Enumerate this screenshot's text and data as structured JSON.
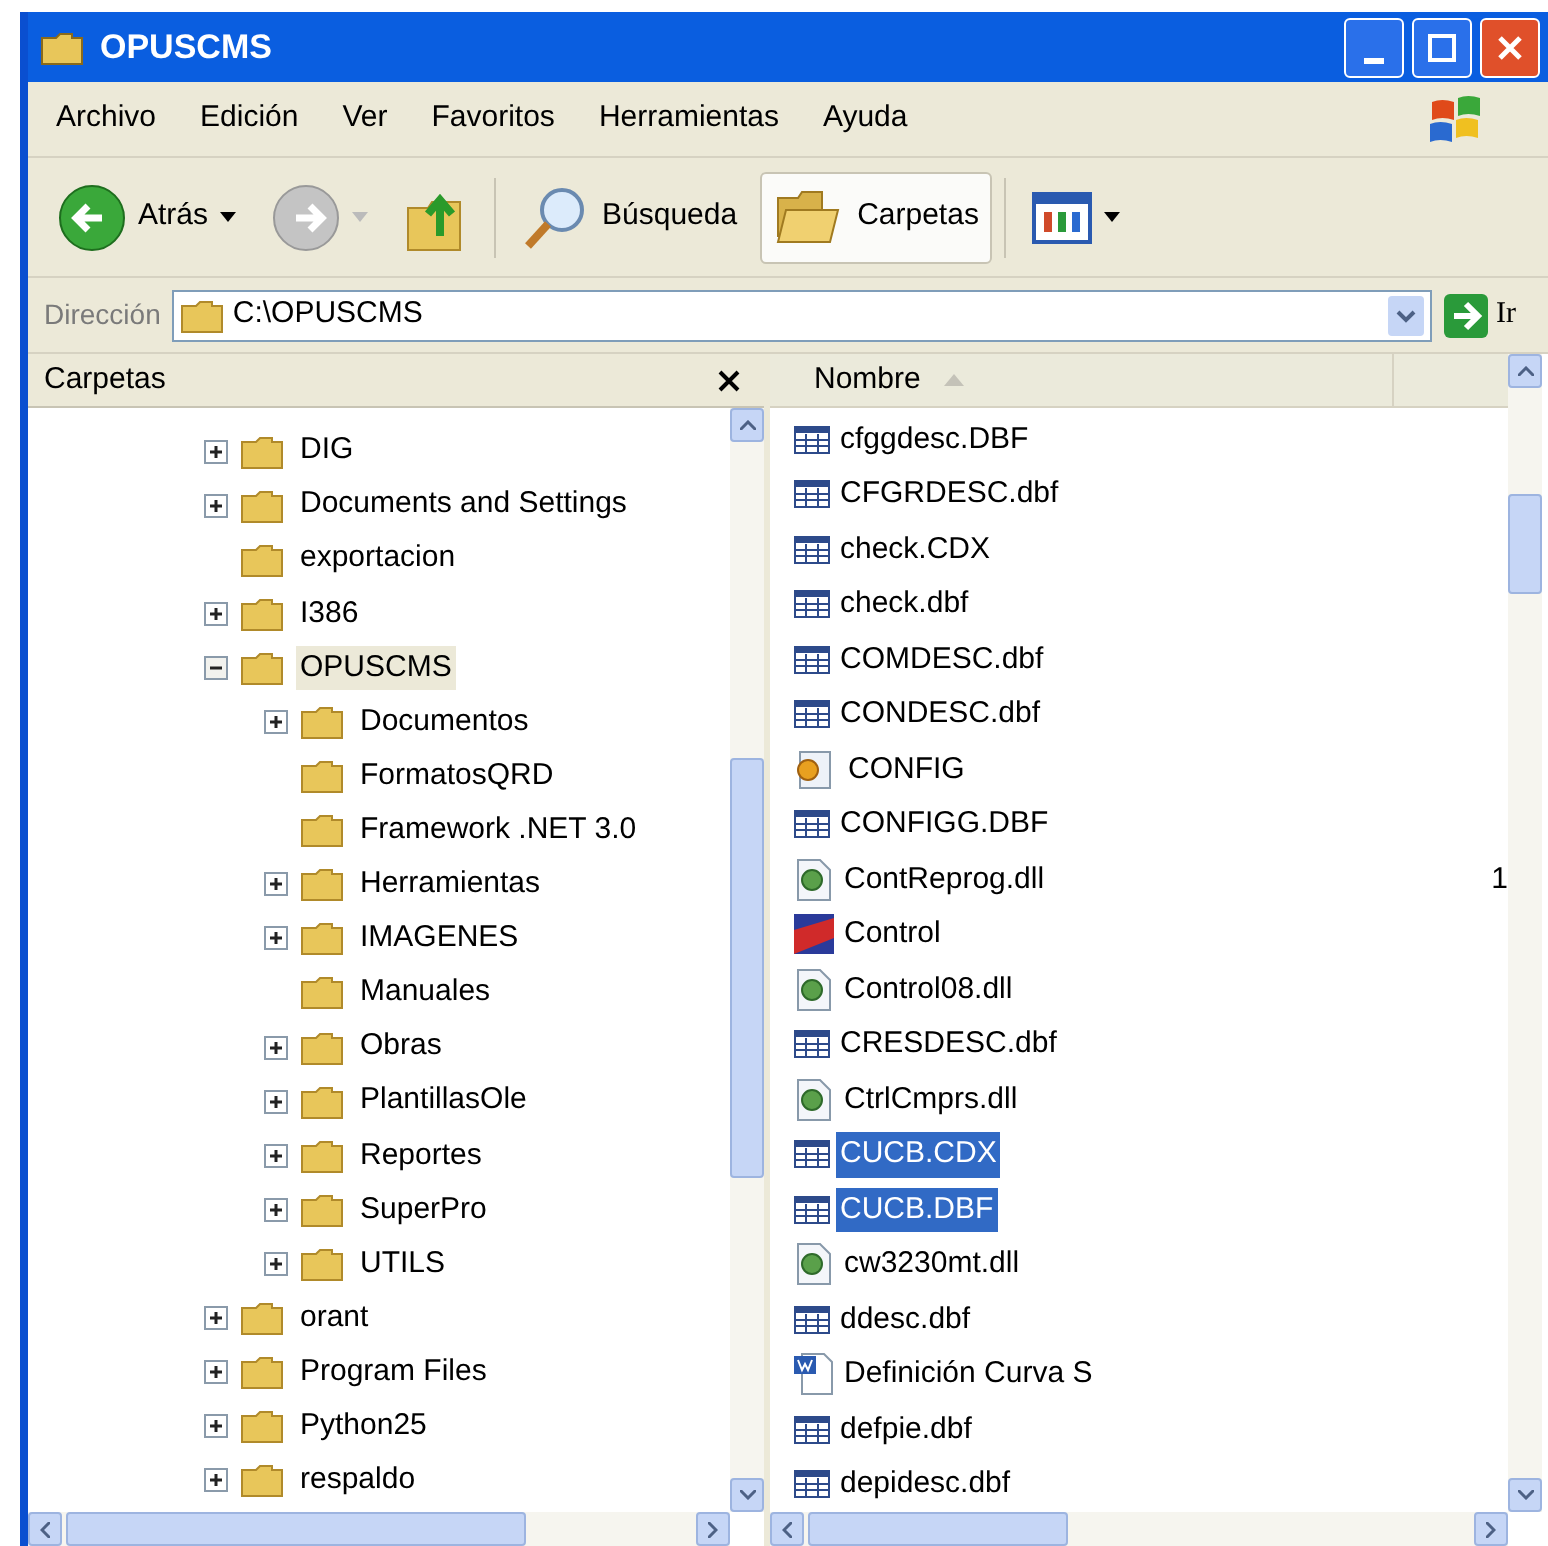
{
  "window": {
    "title": "OPUSCMS"
  },
  "menu": [
    "Archivo",
    "Edición",
    "Ver",
    "Favoritos",
    "Herramientas",
    "Ayuda"
  ],
  "toolbar": [
    {
      "kind": "back",
      "label": "Atrás",
      "disabled": false
    },
    {
      "kind": "forward",
      "disabled": true
    },
    {
      "kind": "up",
      "disabled": false
    },
    {
      "kind": "search",
      "label": "Búsqueda",
      "selected": false
    },
    {
      "kind": "folders",
      "label": "Carpetas",
      "selected": true
    },
    {
      "kind": "views"
    }
  ],
  "address": {
    "label": "Dirección",
    "value": "C:\\OPUSCMS",
    "go": "Ir"
  },
  "folders_pane": {
    "title": "Carpetas",
    "items": [
      {
        "name": "DIG",
        "has_children": true,
        "expanded": false,
        "selected": false
      },
      {
        "name": "Documents and Settings",
        "has_children": true,
        "expanded": false,
        "selected": false
      },
      {
        "name": "exportacion",
        "has_children": false,
        "selected": false
      },
      {
        "name": "I386",
        "has_children": true,
        "expanded": false,
        "selected": false
      },
      {
        "name": "OPUSCMS",
        "has_children": true,
        "expanded": true,
        "selected": true,
        "children": [
          {
            "name": "Documentos",
            "has_children": true,
            "expanded": false,
            "selected": false
          },
          {
            "name": "FormatosQRD",
            "has_children": false,
            "selected": false
          },
          {
            "name": "Framework .NET 3.0",
            "has_children": false,
            "selected": false
          },
          {
            "name": "Herramientas",
            "has_children": true,
            "expanded": false,
            "selected": false
          },
          {
            "name": "IMAGENES",
            "has_children": true,
            "expanded": false,
            "selected": false
          },
          {
            "name": "Manuales",
            "has_children": false,
            "selected": false
          },
          {
            "name": "Obras",
            "has_children": true,
            "expanded": false,
            "selected": false
          },
          {
            "name": "PlantillasOle",
            "has_children": true,
            "expanded": false,
            "selected": false
          },
          {
            "name": "Reportes",
            "has_children": true,
            "expanded": false,
            "selected": false
          },
          {
            "name": "SuperPro",
            "has_children": true,
            "expanded": false,
            "selected": false
          },
          {
            "name": "UTILS",
            "has_children": true,
            "expanded": false,
            "selected": false
          }
        ]
      },
      {
        "name": "orant",
        "has_children": true,
        "expanded": false,
        "selected": false
      },
      {
        "name": "Program Files",
        "has_children": true,
        "expanded": false,
        "selected": false
      },
      {
        "name": "Python25",
        "has_children": true,
        "expanded": false,
        "selected": false
      },
      {
        "name": "respaldo",
        "has_children": true,
        "expanded": false,
        "selected": false
      }
    ]
  },
  "file_list": {
    "columns": [
      "Nombre"
    ],
    "rows": [
      {
        "name": "cfggdesc.DBF",
        "kind": "table",
        "selected": false
      },
      {
        "name": "CFGRDESC.dbf",
        "kind": "table",
        "selected": false
      },
      {
        "name": "check.CDX",
        "kind": "table",
        "selected": false
      },
      {
        "name": "check.dbf",
        "kind": "table",
        "selected": false
      },
      {
        "name": "COMDESC.dbf",
        "kind": "table",
        "selected": false
      },
      {
        "name": "CONDESC.dbf",
        "kind": "table",
        "selected": false
      },
      {
        "name": "CONFIG",
        "kind": "config",
        "selected": false
      },
      {
        "name": "CONFIGG.DBF",
        "kind": "table",
        "selected": false
      },
      {
        "name": "ContReprog.dll",
        "kind": "dll",
        "selected": false,
        "column_2": "1"
      },
      {
        "name": "Control",
        "kind": "app",
        "selected": false
      },
      {
        "name": "Control08.dll",
        "kind": "dll",
        "selected": false
      },
      {
        "name": "CRESDESC.dbf",
        "kind": "table",
        "selected": false
      },
      {
        "name": "CtrlCmprs.dll",
        "kind": "dll",
        "selected": false
      },
      {
        "name": "CUCB.CDX",
        "kind": "table",
        "selected": true
      },
      {
        "name": "CUCB.DBF",
        "kind": "table",
        "selected": true
      },
      {
        "name": "cw3230mt.dll",
        "kind": "dll",
        "selected": false
      },
      {
        "name": "ddesc.dbf",
        "kind": "table",
        "selected": false
      },
      {
        "name": "Definición Curva S",
        "kind": "doc",
        "selected": false
      },
      {
        "name": "defpie.dbf",
        "kind": "table",
        "selected": false
      },
      {
        "name": "depidesc.dbf",
        "kind": "table",
        "selected": false
      }
    ]
  }
}
